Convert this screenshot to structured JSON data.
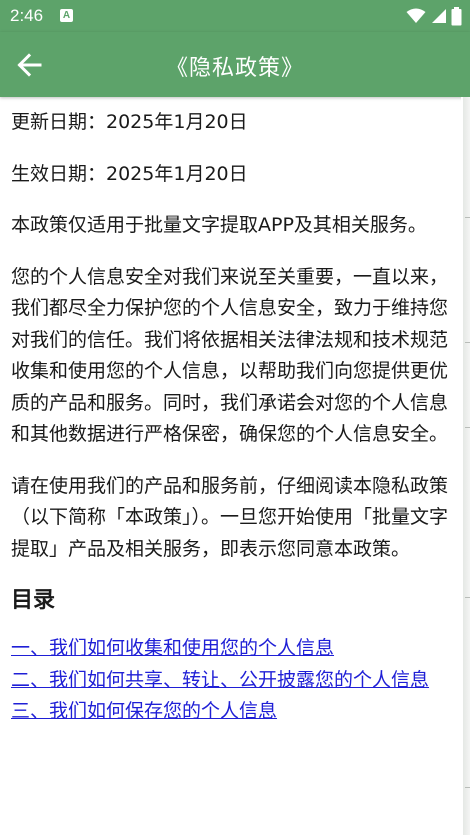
{
  "status_bar": {
    "time": "2:46",
    "notification_letter": "A",
    "icons": [
      "wifi-icon",
      "signal-icon",
      "battery-icon"
    ]
  },
  "app_bar": {
    "title": "《隐私政策》",
    "back_icon": "arrow-left-icon",
    "background_color": "#5da36a"
  },
  "policy": {
    "updated": "更新日期：2025年1月20日",
    "effective": "生效日期：2025年1月20日",
    "scope": "本政策仅适用于批量文字提取APP及其相关服务。",
    "intro": "您的个人信息安全对我们来说至关重要，一直以来，我们都尽全力保护您的个人信息安全，致力于维持您对我们的信任。我们将依据相关法律法规和技术规范收集和使用您的个人信息，以帮助我们向您提供更优质的产品和服务。同时，我们承诺会对您的个人信息和其他数据进行严格保密，确保您的个人信息安全。",
    "notice": "请在使用我们的产品和服务前，仔细阅读本隐私政策（以下简称「本政策」）。一旦您开始使用「批量文字提取」产品及相关服务，即表示您同意本政策。"
  },
  "toc": {
    "heading": "目录",
    "items": [
      "一、我们如何收集和使用您的个人信息",
      "二、我们如何共享、转让、公开披露您的个人信息",
      "三、我们如何保存您的个人信息"
    ],
    "link_color": "#1f1fd6"
  }
}
